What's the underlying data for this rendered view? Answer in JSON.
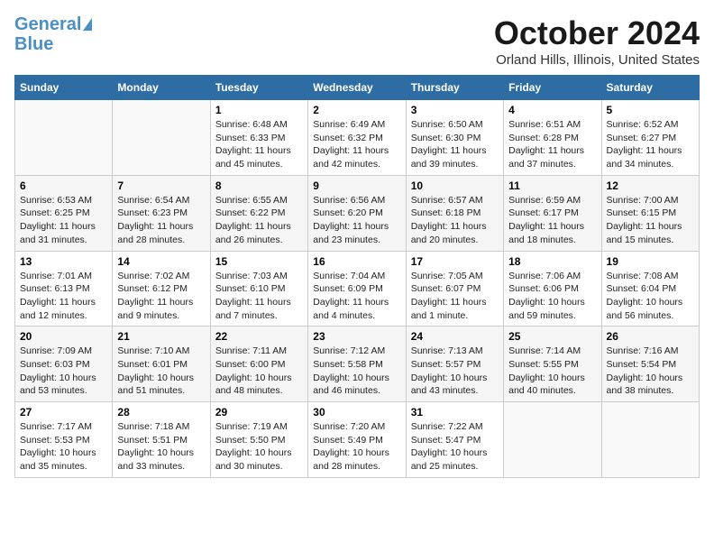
{
  "header": {
    "logo_general": "General",
    "logo_blue": "Blue",
    "month": "October 2024",
    "location": "Orland Hills, Illinois, United States"
  },
  "days_of_week": [
    "Sunday",
    "Monday",
    "Tuesday",
    "Wednesday",
    "Thursday",
    "Friday",
    "Saturday"
  ],
  "weeks": [
    [
      {
        "day": "",
        "info": ""
      },
      {
        "day": "",
        "info": ""
      },
      {
        "day": "1",
        "sunrise": "6:48 AM",
        "sunset": "6:33 PM",
        "daylight": "11 hours and 45 minutes."
      },
      {
        "day": "2",
        "sunrise": "6:49 AM",
        "sunset": "6:32 PM",
        "daylight": "11 hours and 42 minutes."
      },
      {
        "day": "3",
        "sunrise": "6:50 AM",
        "sunset": "6:30 PM",
        "daylight": "11 hours and 39 minutes."
      },
      {
        "day": "4",
        "sunrise": "6:51 AM",
        "sunset": "6:28 PM",
        "daylight": "11 hours and 37 minutes."
      },
      {
        "day": "5",
        "sunrise": "6:52 AM",
        "sunset": "6:27 PM",
        "daylight": "11 hours and 34 minutes."
      }
    ],
    [
      {
        "day": "6",
        "sunrise": "6:53 AM",
        "sunset": "6:25 PM",
        "daylight": "11 hours and 31 minutes."
      },
      {
        "day": "7",
        "sunrise": "6:54 AM",
        "sunset": "6:23 PM",
        "daylight": "11 hours and 28 minutes."
      },
      {
        "day": "8",
        "sunrise": "6:55 AM",
        "sunset": "6:22 PM",
        "daylight": "11 hours and 26 minutes."
      },
      {
        "day": "9",
        "sunrise": "6:56 AM",
        "sunset": "6:20 PM",
        "daylight": "11 hours and 23 minutes."
      },
      {
        "day": "10",
        "sunrise": "6:57 AM",
        "sunset": "6:18 PM",
        "daylight": "11 hours and 20 minutes."
      },
      {
        "day": "11",
        "sunrise": "6:59 AM",
        "sunset": "6:17 PM",
        "daylight": "11 hours and 18 minutes."
      },
      {
        "day": "12",
        "sunrise": "7:00 AM",
        "sunset": "6:15 PM",
        "daylight": "11 hours and 15 minutes."
      }
    ],
    [
      {
        "day": "13",
        "sunrise": "7:01 AM",
        "sunset": "6:13 PM",
        "daylight": "11 hours and 12 minutes."
      },
      {
        "day": "14",
        "sunrise": "7:02 AM",
        "sunset": "6:12 PM",
        "daylight": "11 hours and 9 minutes."
      },
      {
        "day": "15",
        "sunrise": "7:03 AM",
        "sunset": "6:10 PM",
        "daylight": "11 hours and 7 minutes."
      },
      {
        "day": "16",
        "sunrise": "7:04 AM",
        "sunset": "6:09 PM",
        "daylight": "11 hours and 4 minutes."
      },
      {
        "day": "17",
        "sunrise": "7:05 AM",
        "sunset": "6:07 PM",
        "daylight": "11 hours and 1 minute."
      },
      {
        "day": "18",
        "sunrise": "7:06 AM",
        "sunset": "6:06 PM",
        "daylight": "10 hours and 59 minutes."
      },
      {
        "day": "19",
        "sunrise": "7:08 AM",
        "sunset": "6:04 PM",
        "daylight": "10 hours and 56 minutes."
      }
    ],
    [
      {
        "day": "20",
        "sunrise": "7:09 AM",
        "sunset": "6:03 PM",
        "daylight": "10 hours and 53 minutes."
      },
      {
        "day": "21",
        "sunrise": "7:10 AM",
        "sunset": "6:01 PM",
        "daylight": "10 hours and 51 minutes."
      },
      {
        "day": "22",
        "sunrise": "7:11 AM",
        "sunset": "6:00 PM",
        "daylight": "10 hours and 48 minutes."
      },
      {
        "day": "23",
        "sunrise": "7:12 AM",
        "sunset": "5:58 PM",
        "daylight": "10 hours and 46 minutes."
      },
      {
        "day": "24",
        "sunrise": "7:13 AM",
        "sunset": "5:57 PM",
        "daylight": "10 hours and 43 minutes."
      },
      {
        "day": "25",
        "sunrise": "7:14 AM",
        "sunset": "5:55 PM",
        "daylight": "10 hours and 40 minutes."
      },
      {
        "day": "26",
        "sunrise": "7:16 AM",
        "sunset": "5:54 PM",
        "daylight": "10 hours and 38 minutes."
      }
    ],
    [
      {
        "day": "27",
        "sunrise": "7:17 AM",
        "sunset": "5:53 PM",
        "daylight": "10 hours and 35 minutes."
      },
      {
        "day": "28",
        "sunrise": "7:18 AM",
        "sunset": "5:51 PM",
        "daylight": "10 hours and 33 minutes."
      },
      {
        "day": "29",
        "sunrise": "7:19 AM",
        "sunset": "5:50 PM",
        "daylight": "10 hours and 30 minutes."
      },
      {
        "day": "30",
        "sunrise": "7:20 AM",
        "sunset": "5:49 PM",
        "daylight": "10 hours and 28 minutes."
      },
      {
        "day": "31",
        "sunrise": "7:22 AM",
        "sunset": "5:47 PM",
        "daylight": "10 hours and 25 minutes."
      },
      {
        "day": "",
        "info": ""
      },
      {
        "day": "",
        "info": ""
      }
    ]
  ],
  "labels": {
    "sunrise_prefix": "Sunrise: ",
    "sunset_prefix": "Sunset: ",
    "daylight_prefix": "Daylight: "
  }
}
